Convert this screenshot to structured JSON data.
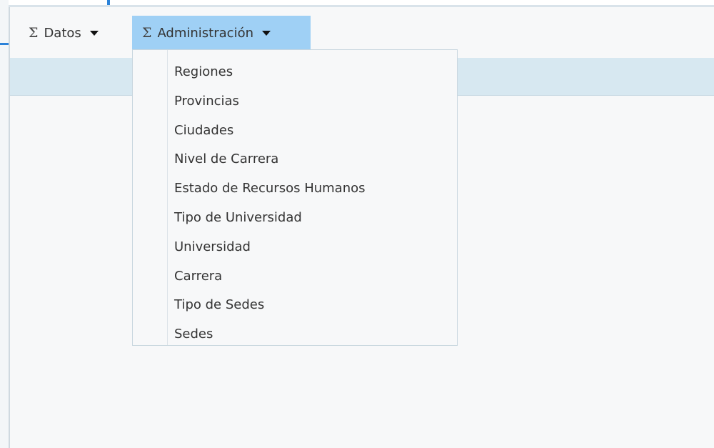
{
  "menubar": {
    "datos": {
      "symbol": "Σ",
      "label": "Datos"
    },
    "administracion": {
      "symbol": "Σ",
      "label": "Administración"
    }
  },
  "dropdown": {
    "items": [
      "Regiones",
      "Provincias",
      "Ciudades",
      "Nivel de Carrera",
      "Estado de Recursos Humanos",
      "Tipo de Universidad",
      "Universidad",
      "Carrera",
      "Tipo de Sedes",
      "Sedes"
    ]
  },
  "colors": {
    "active_menu": "#9fd0f5",
    "accent": "#2b82d9",
    "band": "#d7e8f1",
    "panel": "#f7f8f9"
  }
}
